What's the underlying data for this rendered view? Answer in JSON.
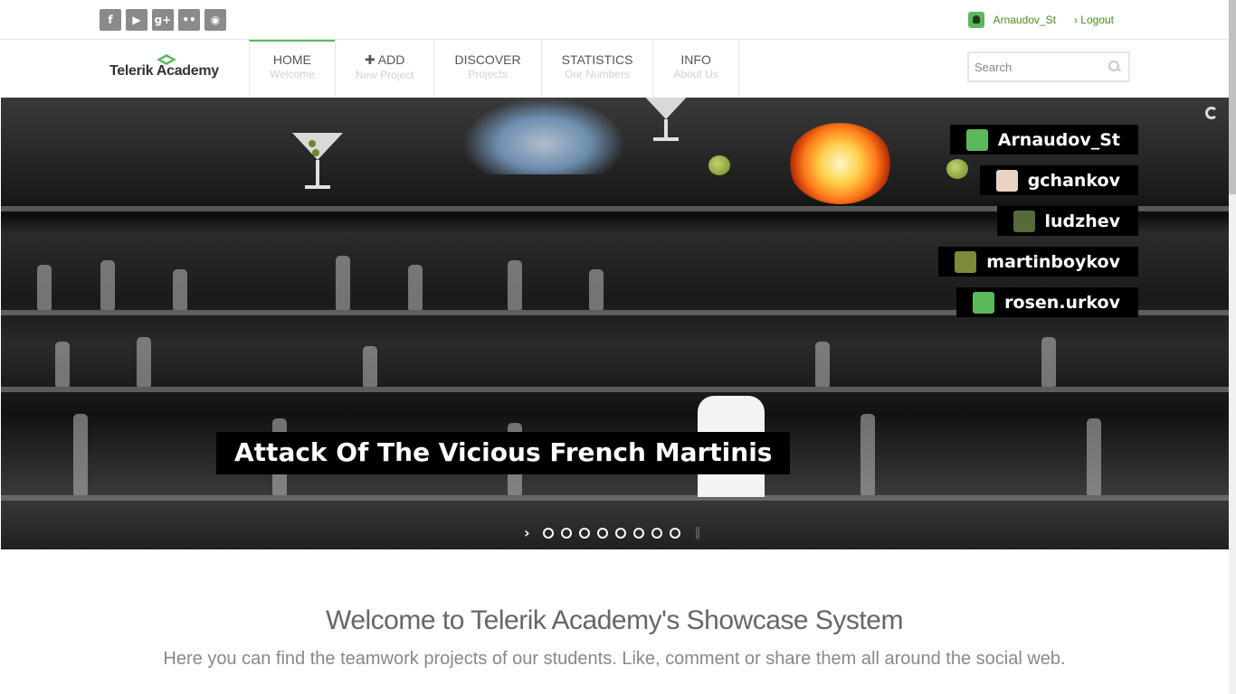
{
  "social": [
    {
      "name": "facebook-icon",
      "glyph": "f"
    },
    {
      "name": "youtube-icon",
      "glyph": "▶"
    },
    {
      "name": "google-plus-icon",
      "glyph": "g+"
    },
    {
      "name": "flickr-icon",
      "glyph": "••"
    },
    {
      "name": "github-icon",
      "glyph": "◉"
    }
  ],
  "user": {
    "name": "Arnaudov_St",
    "logout": "› Logout"
  },
  "logo": {
    "text": "Telerik Academy",
    "color": "#5cb85c"
  },
  "menu": [
    {
      "main": "HOME",
      "sub": "Welcome",
      "active": true
    },
    {
      "main": "✚ ADD",
      "sub": "New Project"
    },
    {
      "main": "DISCOVER",
      "sub": "Projects"
    },
    {
      "main": "STATISTICS",
      "sub": "Our Numbers"
    },
    {
      "main": "INFO",
      "sub": "About Us"
    }
  ],
  "search": {
    "placeholder": "Search"
  },
  "slide": {
    "title": "Attack Of The Vicious French Martinis",
    "authors": [
      {
        "name": "Arnaudov_St",
        "avatar_color": "#5cb85c"
      },
      {
        "name": "gchankov",
        "avatar_color": "#e8d3c4"
      },
      {
        "name": "ludzhev",
        "avatar_color": "#556b3a"
      },
      {
        "name": "martinboykov",
        "avatar_color": "#7c8a3a"
      },
      {
        "name": "rosen.urkov",
        "avatar_color": "#5cb85c"
      }
    ],
    "pager": {
      "count": 8,
      "next": "›",
      "pause": "||"
    }
  },
  "welcome": {
    "title": "Welcome to Telerik Academy's Showcase System",
    "subtitle": "Here you can find the teamwork projects of our students. Like, comment or share them all around the social web."
  }
}
